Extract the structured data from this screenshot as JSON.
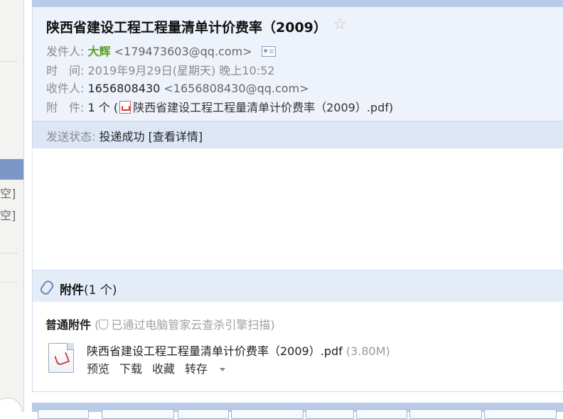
{
  "sidebar": {
    "items": [
      "空]",
      "空]"
    ]
  },
  "email": {
    "subject": "陕西省建设工程工程量清单计价费率（2009）",
    "sender_label": "发件人:",
    "sender_name": "大辉",
    "sender_email": "<179473603@qq.com>",
    "time_label": "时　间:",
    "time_value": "2019年9月29日(星期天) 晚上10:52",
    "recipient_label": "收件人:",
    "recipient_name": "1656808430",
    "recipient_email": "<1656808430@qq.com>",
    "attachment_label": "附　件:",
    "attachment_count": "1 个 (",
    "attachment_file": "陕西省建设工程工程量清单计价费率（2009）.pdf)",
    "status_label": "发送状态:",
    "status_value": "投递成功",
    "status_detail": "[查看详情]"
  },
  "attachments": {
    "title": "附件",
    "count": "(1 个)",
    "section_label": "普通附件",
    "scan_note": "(",
    "scan_text": "已通过电脑管家云查杀引擎扫描)",
    "file_name": "陕西省建设工程工程量清单计价费率（2009）.pdf",
    "file_size": "(3.80M)",
    "actions": {
      "preview": "预览",
      "download": "下载",
      "favorite": "收藏",
      "save_to": "转存"
    }
  },
  "colors": {
    "header_bg": "#eef3fb",
    "status_bg": "#dde6f5",
    "sender_name": "#5a9e1e",
    "accent_bar": "#b9cbe9"
  },
  "icons": {
    "star": "star-icon",
    "vcard": "contact-card-icon",
    "pdf": "pdf-icon",
    "clip": "paperclip-icon",
    "shield": "shield-icon"
  }
}
